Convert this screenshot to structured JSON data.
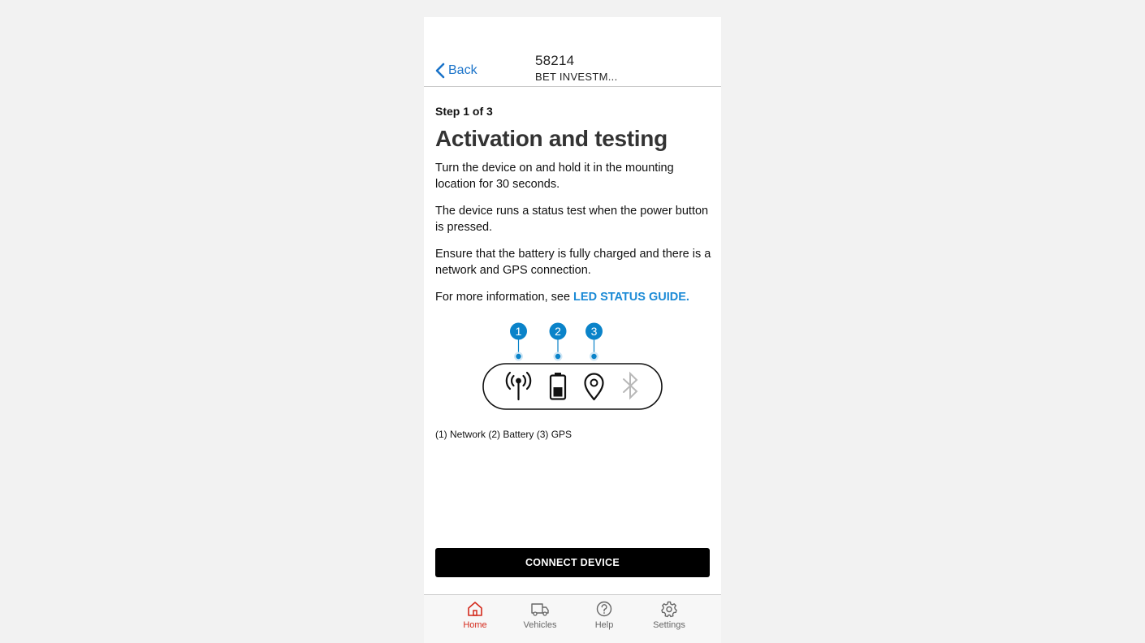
{
  "header": {
    "back_label": "Back",
    "title": "58214",
    "subtitle": "BET INVESTM..."
  },
  "content": {
    "step": "Step 1 of 3",
    "heading": "Activation and testing",
    "paragraphs": [
      "Turn the device on and hold it in the mounting location for 30 seconds.",
      "The device runs a status test when the power button is pressed.",
      "Ensure that the battery is fully charged and there is a network and GPS connection."
    ],
    "more_info_prefix": "For more information, see ",
    "more_info_link": "LED STATUS GUIDE."
  },
  "diagram": {
    "markers": [
      "1",
      "2",
      "3"
    ],
    "icons": [
      "network-antenna-icon",
      "battery-icon",
      "gps-pin-icon",
      "bluetooth-icon"
    ],
    "caption": "(1) Network (2) Battery (3) GPS",
    "accent": "#0a83c9"
  },
  "actions": {
    "connect_label": "CONNECT DEVICE"
  },
  "tabbar": {
    "items": [
      {
        "label": "Home",
        "icon": "home-icon",
        "active": true
      },
      {
        "label": "Vehicles",
        "icon": "truck-icon",
        "active": false
      },
      {
        "label": "Help",
        "icon": "help-circle-icon",
        "active": false
      },
      {
        "label": "Settings",
        "icon": "gear-icon",
        "active": false
      }
    ]
  },
  "colors": {
    "link": "#1b8ad6",
    "back": "#1a73c9",
    "active_tab": "#d42a1c"
  }
}
